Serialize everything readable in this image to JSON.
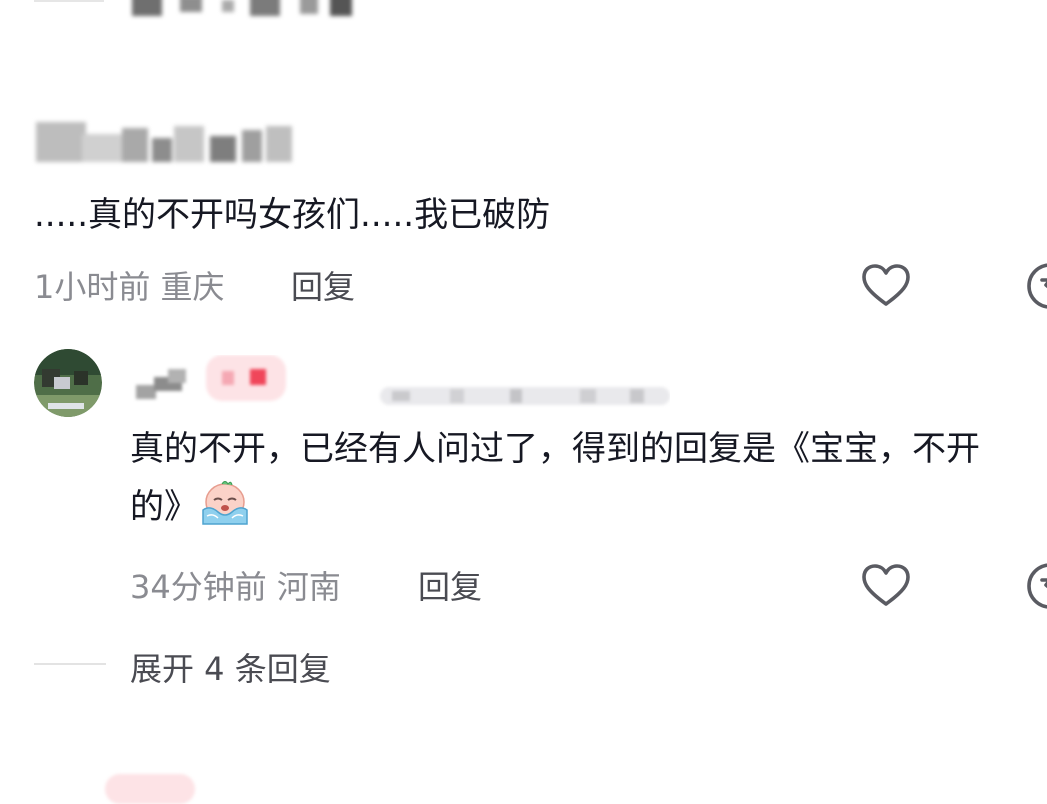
{
  "comment": {
    "text": ".....真的不开吗女孩们.....我已破防",
    "time_location": "1小时前 重庆",
    "reply_label": "回复"
  },
  "reply": {
    "text": "真的不开，已经有人问过了，得到的回复是《宝宝，不开的》",
    "emoji": "crying-face-emoji",
    "time_location": "34分钟前 河南",
    "reply_label": "回复"
  },
  "expand": {
    "label": "展开 4 条回复"
  },
  "icons": {
    "like": "heart-icon",
    "dislike": "dislike-icon"
  },
  "colors": {
    "text": "#161823",
    "meta": "#8a8b91",
    "action": "#4a4b52",
    "badge": "#fde3e6",
    "badge_accent": "#f0465a"
  }
}
